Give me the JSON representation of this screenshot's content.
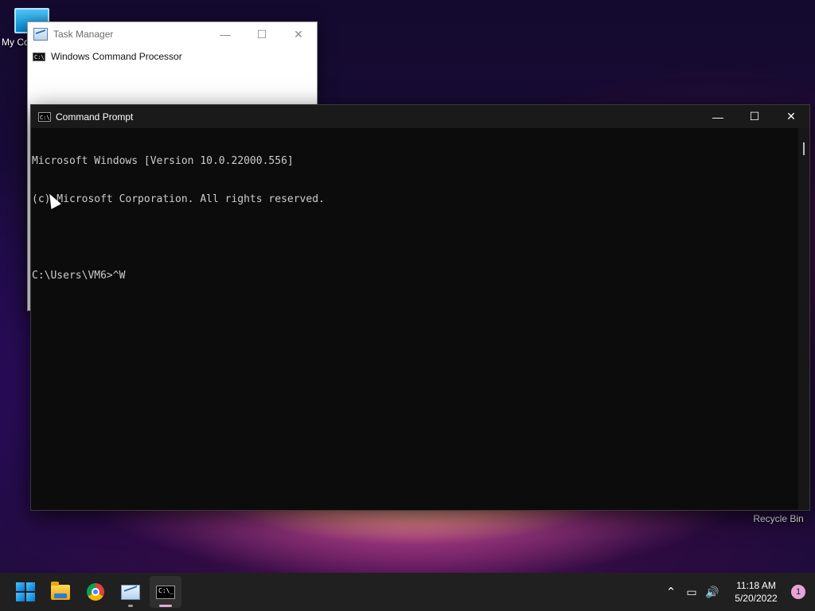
{
  "desktop": {
    "icons": [
      {
        "label": "My Co"
      },
      {
        "label": "Recycle Bin"
      }
    ]
  },
  "task_manager": {
    "title": "Task Manager",
    "minimize": "—",
    "maximize": "☐",
    "close": "✕",
    "process_icon_text": "C:\\",
    "process_name": "Windows Command Processor"
  },
  "command_prompt": {
    "title": "Command Prompt",
    "icon_text": "C:\\",
    "minimize": "—",
    "maximize": "☐",
    "close": "✕",
    "lines": [
      "Microsoft Windows [Version 10.0.22000.556]",
      "(c) Microsoft Corporation. All rights reserved.",
      "",
      "C:\\Users\\VM6>^W"
    ]
  },
  "taskbar": {
    "cmd_icon_text": "C:\\_",
    "tray": {
      "chevron": "⌃",
      "network": "▭",
      "volume": "🔊",
      "time": "11:18 AM",
      "date": "5/20/2022",
      "notifications": "1"
    }
  }
}
